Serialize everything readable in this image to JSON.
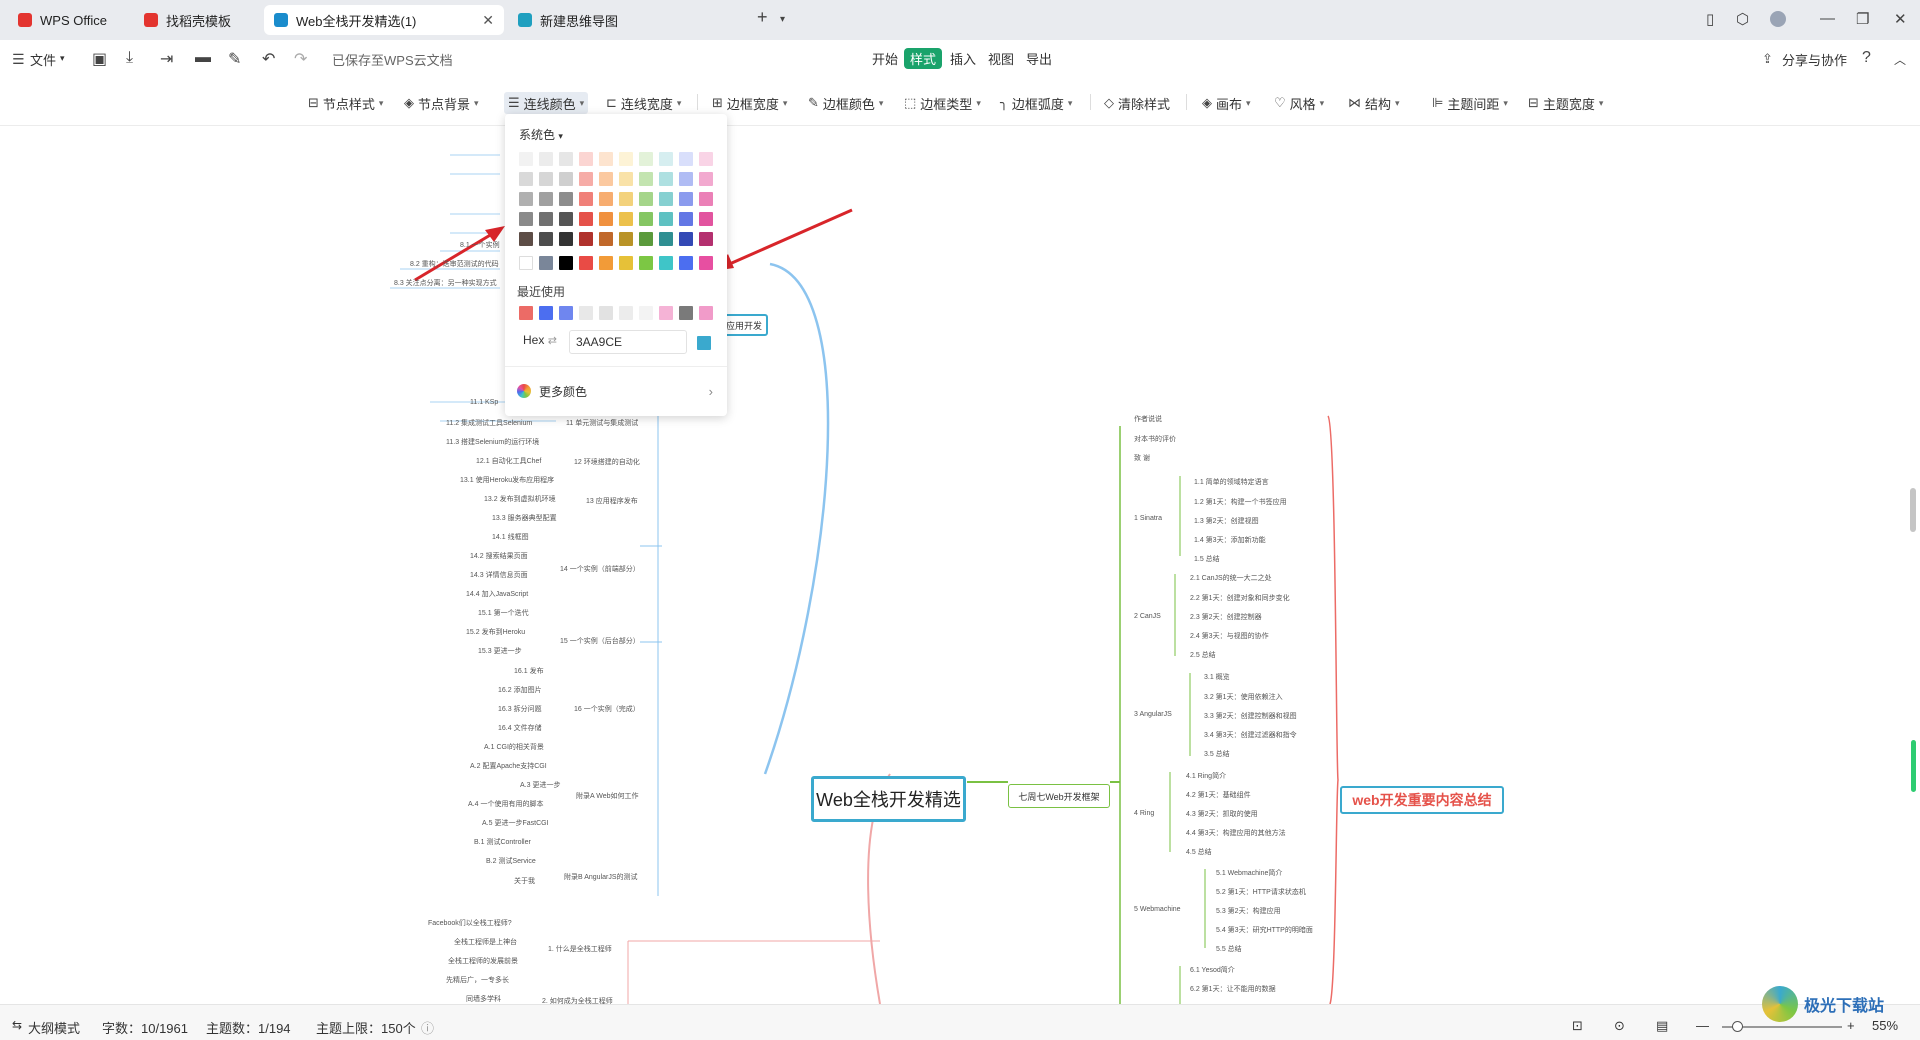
{
  "tabs": [
    {
      "label": "WPS Office"
    },
    {
      "label": "找稻壳模板"
    },
    {
      "label": "Web全栈开发精选(1)"
    },
    {
      "label": "新建思维导图"
    }
  ],
  "menubar": {
    "file_label": "文件",
    "saved_status": "已保存至WPS云文档",
    "center_items": [
      "开始",
      "样式",
      "插入",
      "视图",
      "导出"
    ],
    "active_item": "样式",
    "share_label": "分享与协作"
  },
  "toolbar": {
    "node_style": "节点样式",
    "node_bg": "节点背景",
    "line_color": "连线颜色",
    "line_width": "连线宽度",
    "border_width": "边框宽度",
    "border_color": "边框颜色",
    "border_type": "边框类型",
    "border_radius": "边框弧度",
    "clear_style": "清除样式",
    "canvas": "画布",
    "theme_style": "风格",
    "structure": "结构",
    "topic_spacing": "主题间距",
    "topic_width": "主题宽度"
  },
  "popup": {
    "section_system": "系统色",
    "section_recent": "最近使用",
    "hex_label": "Hex",
    "hex_value": "3AA9CE",
    "hex_preview_color": "#3AA9CE",
    "more_colors": "更多颜色",
    "grid_colors": [
      [
        "#f2f2f2",
        "#ececec",
        "#e6e6e6",
        "#fbd5d2",
        "#fde4cf",
        "#fdf3d6",
        "#e3f2d9",
        "#d6eef0",
        "#d9dffb",
        "#f9d4e6"
      ],
      [
        "#d9d9d9",
        "#d6d6d6",
        "#cfcfcf",
        "#f6aca7",
        "#fbc9a0",
        "#f9e2a8",
        "#c3e4b0",
        "#aee0e1",
        "#b0bcf4",
        "#f2a9cf"
      ],
      [
        "#b0b0b0",
        "#a0a0a0",
        "#8d8d8d",
        "#f08079",
        "#f7ad70",
        "#f3d27c",
        "#a5d58a",
        "#86d0d1",
        "#8b9bee",
        "#eb80b7"
      ],
      [
        "#8a8a8a",
        "#707070",
        "#555555",
        "#e5524a",
        "#f0913f",
        "#ecc14c",
        "#85c663",
        "#5ec1c2",
        "#6377e5",
        "#e2549f"
      ],
      [
        "#5d4d46",
        "#4d4d4d",
        "#333333",
        "#b0322c",
        "#c0682a",
        "#b99327",
        "#5b9a3c",
        "#2f8f92",
        "#3349b5",
        "#b4306f"
      ],
      [
        "#ffffff",
        "#7a8699",
        "#000000",
        "#e94b45",
        "#f29b38",
        "#e6c138",
        "#7cc744",
        "#3fc5c8",
        "#4c6ef0",
        "#e74fa1"
      ]
    ],
    "recent_colors": [
      "#ec6b66",
      "#4c6ef0",
      "#6f86ef",
      "#e8e8e8",
      "#e2e2e2",
      "#ececec",
      "#f3f3f3",
      "#f5b3d6",
      "#7a7a7a",
      "#f19bc9"
    ]
  },
  "mindmap": {
    "central": "Web全栈开发精选",
    "branch_book": "七周七Web开发框架",
    "summary": "web开发重要内容总结",
    "left_partial": "应用开发",
    "left_nodes": [
      "8.1 一个实例",
      "8.2 重构：迭审范测试的代码",
      "8.3 关注点分离：另一种实现方式",
      "11.1 KSp",
      "11.2 集成测试工具Selenium",
      "11.3 搭建Selenium的运行环境",
      "12.1 自动化工具Chef",
      "13.1 使用Heroku发布应用程序",
      "13.2 发布到虚拟机环境",
      "13.3 服务器典型配置",
      "14.1 线框图",
      "14.2 搜索结果页面",
      "14.3 详情信息页面",
      "14.4 加入JavaScript",
      "15.1 第一个迭代",
      "15.2 发布到Heroku",
      "15.3 更进一步",
      "16.1 发布",
      "16.2 添加图片",
      "16.3 拆分问题",
      "16.4 文件存储",
      "A.1 CGI的相关背景",
      "A.2 配置Apache支持CGI",
      "A.3 更进一步",
      "A.4 一个使用有用的脚本",
      "A.5 更进一步FastCGI",
      "B.1 测试Controller",
      "B.2 测试Service",
      "关于我",
      "Facebook们以全栈工程师?",
      "全栈工程师是上神台",
      "全栈工程师的发展前景",
      "先精后广，一专多长",
      "同墙多学科"
    ],
    "left_groups": [
      "11 单元测试与集成测试",
      "12 环境搭建的自动化",
      "13 应用程序发布",
      "14 一个实例（前端部分）",
      "15 一个实例（后台部分）",
      "16 一个实例（完成）",
      "附录A Web如何工作",
      "附录B AngularJS的测试",
      "1. 什么是全栈工程师",
      "2. 如何成为全栈工程师"
    ],
    "right_nodes": [
      "作者说说",
      "对本书的评价",
      "致 谢",
      "1 Sinatra",
      "1.1 简单的领域特定语言",
      "1.2 第1天：构建一个书签应用",
      "1.3 第2天：创建视图",
      "1.4 第3天：添加新功能",
      "1.5 总结",
      "2 CanJS",
      "2.1 CanJS的统一大二之处",
      "2.2 第1天：创建对象和同步变化",
      "2.3 第2天：创建控制器",
      "2.4 第3天：与视图的协作",
      "2.5 总结",
      "3 AngularJS",
      "3.1 概览",
      "3.2 第1天：使用依赖注入",
      "3.3 第2天：创建控制器和视图",
      "3.4 第3天：创建过滤器和指令",
      "3.5 总结",
      "4 Ring",
      "4.1 Ring简介",
      "4.2 第1天：基础组件",
      "4.3 第2天：抓取的使用",
      "4.4 第3天：构建应用的其他方法",
      "4.5 总结",
      "5 Webmachine",
      "5.1 Webmachine简介",
      "5.2 第1天：HTTP请求状态机",
      "5.3 第2天：构建应用",
      "5.4 第3天：研究HTTP的明暗面",
      "5.5 总结",
      "6.1 Yesod简介",
      "6.2 第1天：让不能用的数据"
    ]
  },
  "statusbar": {
    "outline_mode": "大纲模式",
    "word_count": "字数：10/1961",
    "topic_count": "主题数：1/194",
    "topic_limit": "主题上限：150个",
    "zoom": "55%"
  },
  "watermark": "极光下载站"
}
